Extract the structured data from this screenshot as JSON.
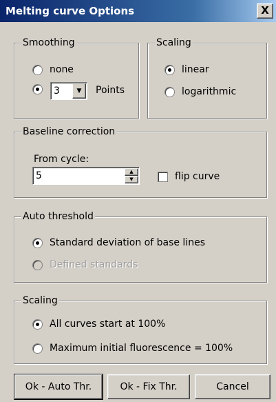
{
  "window": {
    "title": "Melting curve Options",
    "close_label": "X"
  },
  "smoothing": {
    "legend": "Smoothing",
    "none_label": "none",
    "points_value": "3",
    "points_label": "Points",
    "selected": "points"
  },
  "scaling_top": {
    "legend": "Scaling",
    "linear_label": "linear",
    "log_label": "logarithmic",
    "selected": "linear"
  },
  "baseline": {
    "legend": "Baseline correction",
    "from_cycle_label": "From cycle:",
    "from_cycle_value": "5",
    "flip_label": "flip curve",
    "flip_checked": false
  },
  "auto_threshold": {
    "legend": "Auto threshold",
    "std_label": "Standard deviation of base lines",
    "defined_label": "Defined standards",
    "selected": "std"
  },
  "scaling_bottom": {
    "legend": "Scaling",
    "all_100_label": "All curves start at 100%",
    "max_initial_label": "Maximum initial fluorescence = 100%",
    "selected": "all_100"
  },
  "buttons": {
    "ok_auto": "Ok - Auto Thr.",
    "ok_fix": "Ok - Fix Thr.",
    "cancel": "Cancel"
  }
}
